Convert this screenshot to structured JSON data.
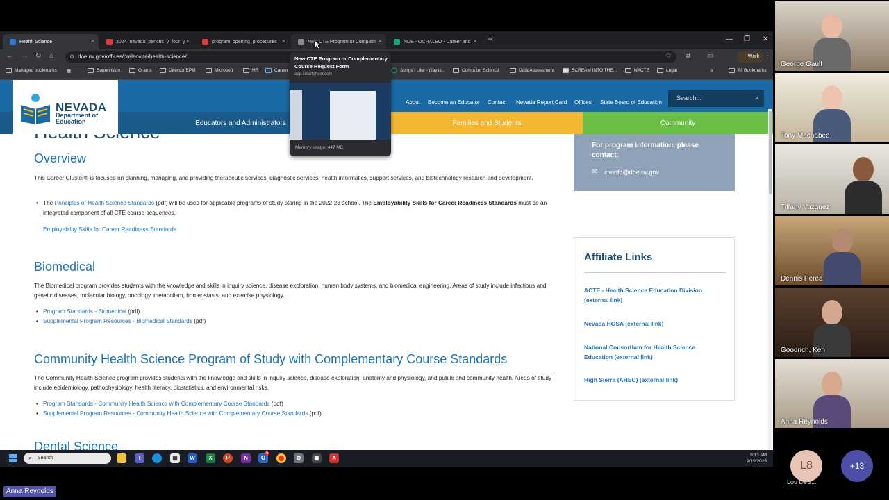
{
  "browser": {
    "tabs": [
      {
        "label": "Health Science",
        "icon_color": "#2b7bd4"
      },
      {
        "label": "2024_nevada_perkins_v_four_y",
        "icon_color": "#e53935"
      },
      {
        "label": "program_opening_procedures",
        "icon_color": "#e53935"
      },
      {
        "label": "New CTE Program or Complem",
        "icon_color": "#8a8a8a"
      },
      {
        "label": "NDE - OCRALEO - Career and",
        "icon_color": "#1aa37a"
      }
    ],
    "new_tab": "+",
    "url": "doe.nv.gov/offices/craleo/cte/health-science/",
    "profile_label": "Work",
    "bookmarks": [
      "Managed bookmarks",
      "Supervision",
      "Grants",
      "Director/EPM",
      "Microsoft",
      "HR",
      "Career",
      "Songs I Like - playlis...",
      "Computer Science",
      "Data/Assessment",
      "SCREAM INTO THE...",
      "NACTE",
      "Legal"
    ],
    "all_bookmarks": "All Bookmarks",
    "more_bookmarks": "»",
    "tab_hover": {
      "title": "New CTE Program or Complementary Course Request Form",
      "url": "app.smartsheet.com",
      "memory": "Memory usage: 447 MB"
    }
  },
  "site": {
    "logo_line1": "NEVADA",
    "logo_line2": "Department of",
    "logo_line3": "Education",
    "util_links": [
      "About",
      "Become an Educator",
      "Contact",
      "Nevada Report Card",
      "Offices",
      "State Board of Education"
    ],
    "search_placeholder": "Search...",
    "main_nav": [
      {
        "label": "Educators and Administrators",
        "color": "#1a5b8c"
      },
      {
        "label": "Families and Students",
        "color": "#f2b632"
      },
      {
        "label": "Community",
        "color": "#6abd45"
      }
    ],
    "page_title": "Health Science",
    "overview": {
      "heading": "Overview",
      "intro": "This Career Cluster® is focused on planning, managing, and providing therapeutic services, diagnostic services, health informatics, support services, and biotechnology research and development.",
      "bullet1_a": "The ",
      "bullet1_link": "Principles of Health Science Standards",
      "bullet1_b": " (pdf) will be used for applicable programs of study staring in the 2022-23 school. The ",
      "bullet1_bold": "Employability Skills for Career Readiness Standards",
      "bullet1_c": " must be an integrated component of all CTE course sequences.",
      "link2": "Employability Skills for Career Readiness Standards"
    },
    "biomedical": {
      "heading": "Biomedical",
      "body": "The Biomedical program provides students with the knowledge and skills in inquiry science, disease exploration, human body systems, and biomedical engineering. Areas of study include infectious and genetic diseases, molecular biology, oncology, metabolism, homeostasis, and exercise physiology.",
      "link1": "Program Standards - Biomedical",
      "link2": "Supplemental Program Resources - Biomedical Standards",
      "pdf": " (pdf)"
    },
    "community": {
      "heading": "Community Health Science Program of Study with Complementary Course Standards",
      "body": "The Community Health Science program provides students with the knowledge and skills in inquiry science, disease exploration, anatomy and physiology, and public and community health. Areas of study include epidemiology, pathophysiology, health literacy, biostatistics, and environmental risks.",
      "link1": "Program Standards - Community Health Science with Complementary Course Standards",
      "link2": "Supplemental Program Resources - Community Health Science with Complementary Course Standards",
      "pdf": " (pdf)"
    },
    "next_heading_partial": "Dental Science",
    "contact": {
      "title": "For program information, please contact:",
      "email": "cteinfo@doe.nv.gov"
    },
    "affiliate": {
      "heading": "Affiliate Links",
      "links": [
        "ACTE - Health Science Education Division (external link)",
        "Nevada HOSA (external link)",
        "National Consortium for Health Science Education (external link)",
        "High Sierra (AHEC) (external link)"
      ]
    }
  },
  "taskbar": {
    "search_label": "Search",
    "time": "9:13 AM",
    "date": "9/19/2025",
    "mail_badge": "5"
  },
  "meeting": {
    "participants": [
      "George Gault",
      "Tony Machabee",
      "Tiffany Vazquez",
      "Dennis Perea",
      "Goodrich, Ken",
      "Anna Reynolds"
    ],
    "avatar_initials": "L8",
    "avatar_name": "Lou DeS...",
    "more_count": "+13",
    "presenter": "Anna Reynolds"
  }
}
